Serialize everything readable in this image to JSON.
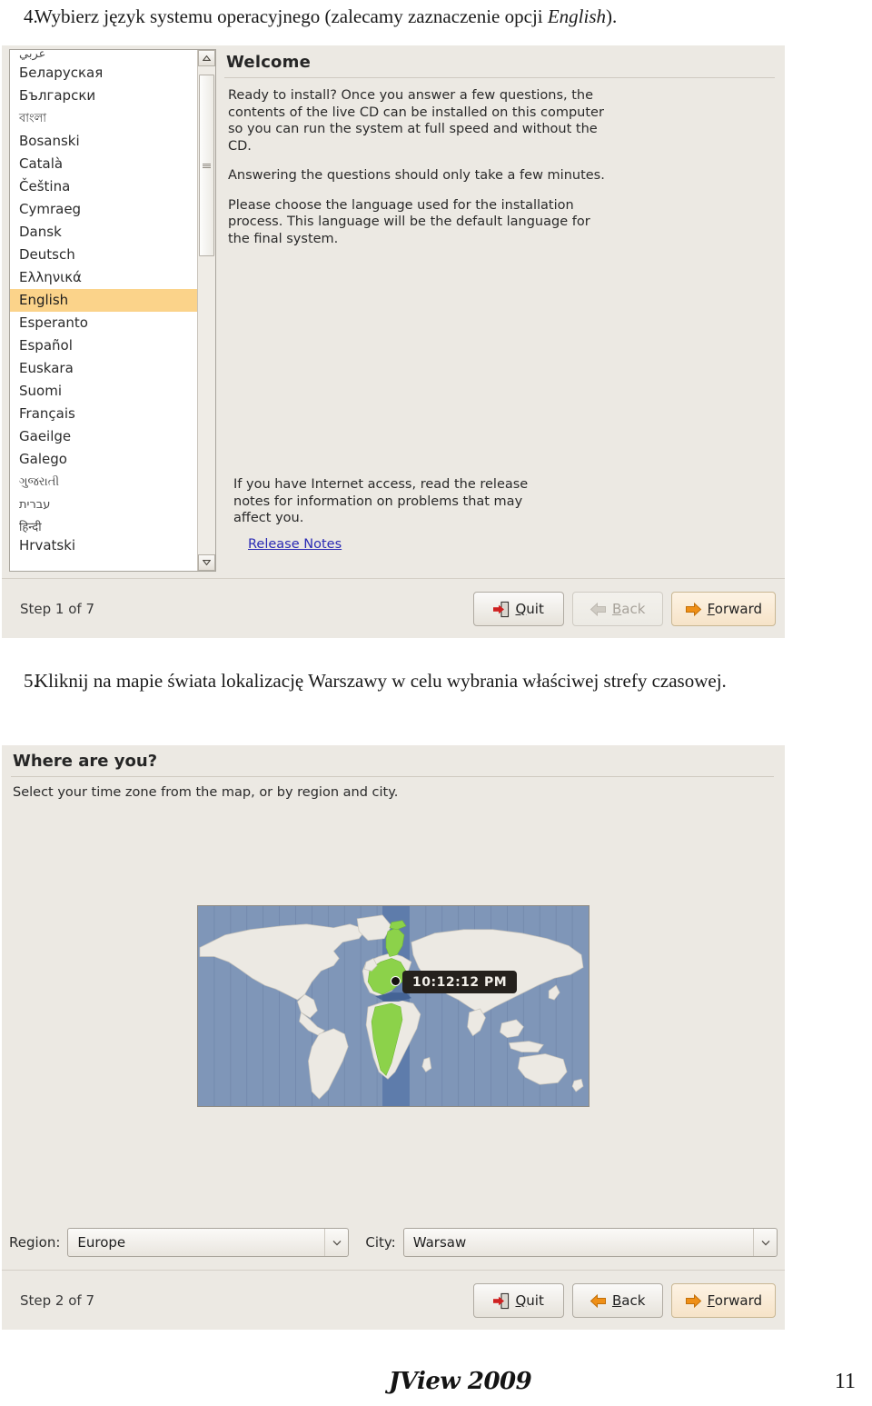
{
  "document": {
    "step4": {
      "number": "4.",
      "text_before": "Wybierz język systemu operacyjnego (zalecamy zaznaczenie opcji ",
      "emphasis": "English",
      "text_after": ")."
    },
    "step5": {
      "number": "5.",
      "text": "Kliknij na mapie świata lokalizację Warszawy w celu wybrania właściwej strefy czasowej."
    },
    "footer": {
      "brand": "JView 2009",
      "page_number": "11"
    }
  },
  "installer_language": {
    "language_list": {
      "items": [
        {
          "label": "عربي",
          "style": "rtl",
          "selected": false
        },
        {
          "label": "Беларуская",
          "style": "normal",
          "selected": false
        },
        {
          "label": "Български",
          "style": "normal",
          "selected": false
        },
        {
          "label": "বাংলা",
          "style": "small",
          "selected": false
        },
        {
          "label": "Bosanski",
          "style": "normal",
          "selected": false
        },
        {
          "label": "Català",
          "style": "normal",
          "selected": false
        },
        {
          "label": "Čeština",
          "style": "normal",
          "selected": false
        },
        {
          "label": "Cymraeg",
          "style": "normal",
          "selected": false
        },
        {
          "label": "Dansk",
          "style": "normal",
          "selected": false
        },
        {
          "label": "Deutsch",
          "style": "normal",
          "selected": false
        },
        {
          "label": "Ελληνικά",
          "style": "normal",
          "selected": false
        },
        {
          "label": "English",
          "style": "normal",
          "selected": true
        },
        {
          "label": "Esperanto",
          "style": "normal",
          "selected": false
        },
        {
          "label": "Español",
          "style": "normal",
          "selected": false
        },
        {
          "label": "Euskara",
          "style": "normal",
          "selected": false
        },
        {
          "label": "Suomi",
          "style": "normal",
          "selected": false
        },
        {
          "label": "Français",
          "style": "normal",
          "selected": false
        },
        {
          "label": "Gaeilge",
          "style": "normal",
          "selected": false
        },
        {
          "label": "Galego",
          "style": "normal",
          "selected": false
        },
        {
          "label": "ગુજરાતી",
          "style": "small",
          "selected": false
        },
        {
          "label": "עברית",
          "style": "small",
          "selected": false
        },
        {
          "label": "हिन्दी",
          "style": "small",
          "selected": false
        },
        {
          "label": "Hrvatski",
          "style": "normal",
          "selected": false
        }
      ],
      "selected_value": "English"
    },
    "welcome": {
      "title": "Welcome",
      "paragraph1": "Ready to install? Once you answer a few questions, the contents of the live CD can be installed on this computer so you can run the system at full speed and without the CD.",
      "paragraph2": "Answering the questions should only take a few minutes.",
      "paragraph3": "Please choose the language used for the installation process. This language will be the default language for the final system.",
      "paragraph4": "If you have Internet access, read the release notes for information on problems that may affect you.",
      "release_notes_link": "Release Notes"
    },
    "footer": {
      "step_label": "Step 1 of 7",
      "quit_label": "Quit",
      "quit_mnemonic": "Q",
      "back_label": "Back",
      "back_mnemonic": "B",
      "back_disabled": true,
      "forward_label": "Forward",
      "forward_mnemonic": "F"
    }
  },
  "installer_timezone": {
    "title": "Where are you?",
    "subtitle": "Select your time zone from the map, or by region and city.",
    "map": {
      "clock_tooltip": "10:12:12 PM",
      "selected_marker": "warsaw-location"
    },
    "region": {
      "label": "Region:",
      "value": "Europe"
    },
    "city": {
      "label": "City:",
      "value": "Warsaw"
    },
    "footer": {
      "step_label": "Step 2 of 7",
      "quit_label": "Quit",
      "quit_mnemonic": "Q",
      "back_label": "Back",
      "back_mnemonic": "B",
      "back_disabled": false,
      "forward_label": "Forward",
      "forward_mnemonic": "F"
    }
  },
  "colors": {
    "selection_highlight": "#fbd38a",
    "dialog_background": "#ece9e3",
    "link_blue": "#2b2bb4",
    "map_ocean": "#7f96b8",
    "map_land": "#ece9e3",
    "map_highlight_green": "#8cd24a",
    "tooltip_background": "#25211d",
    "primary_button": "#f6e3c8"
  }
}
